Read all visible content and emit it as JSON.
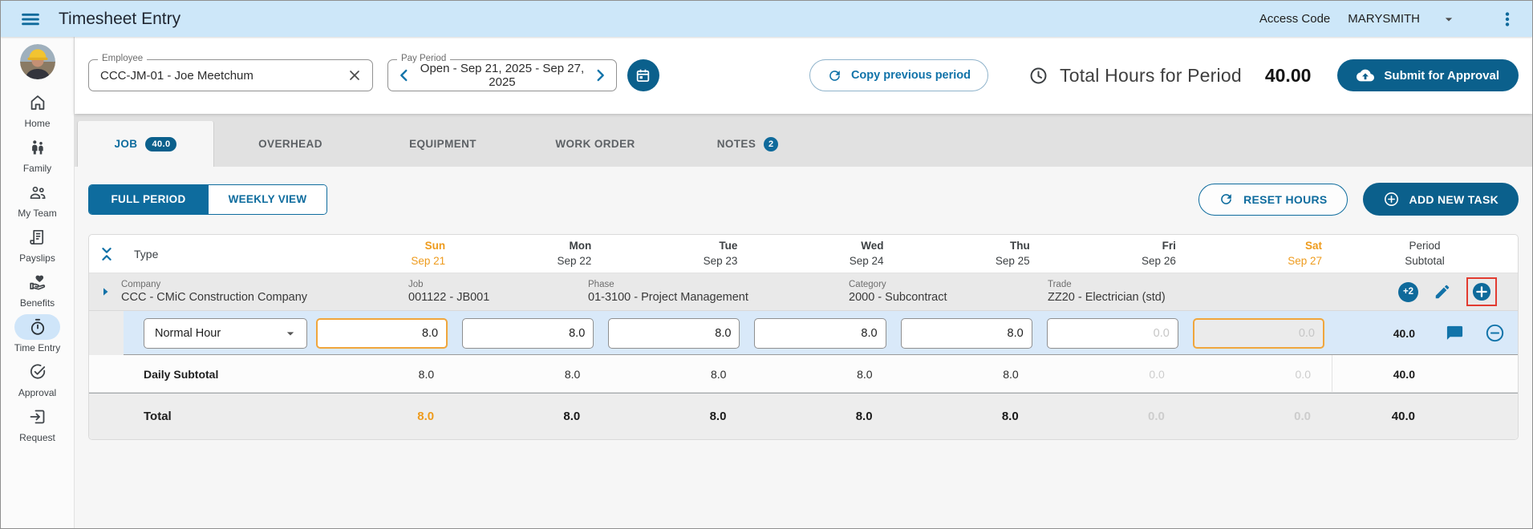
{
  "topbar": {
    "title": "Timesheet Entry",
    "access_code_label": "Access Code",
    "access_code_value": "MARYSMITH"
  },
  "sidebar": {
    "items": [
      {
        "label": "Home"
      },
      {
        "label": "Family"
      },
      {
        "label": "My Team"
      },
      {
        "label": "Payslips"
      },
      {
        "label": "Benefits"
      },
      {
        "label": "Time Entry"
      },
      {
        "label": "Approval"
      },
      {
        "label": "Request"
      }
    ]
  },
  "header": {
    "employee_label": "Employee",
    "employee_value": "CCC-JM-01 - Joe Meetchum",
    "pay_period_label": "Pay Period",
    "pay_period_value": "Open - Sep 21, 2025 - Sep 27, 2025",
    "copy_previous_label": "Copy previous period",
    "total_hours_label": "Total Hours for Period",
    "total_hours_value": "40.00",
    "submit_label": "Submit for Approval"
  },
  "tabs": {
    "job": {
      "label": "JOB",
      "badge": "40.0"
    },
    "overhead": {
      "label": "OVERHEAD"
    },
    "equipment": {
      "label": "EQUIPMENT"
    },
    "work_order": {
      "label": "WORK ORDER"
    },
    "notes": {
      "label": "NOTES",
      "badge": "2"
    }
  },
  "toolbar": {
    "full_period": "FULL PERIOD",
    "weekly_view": "WEEKLY VIEW",
    "reset_label": "RESET HOURS",
    "add_task_label": "ADD NEW TASK"
  },
  "table": {
    "type_header": "Type",
    "period_header_line1": "Period",
    "period_header_line2": "Subtotal",
    "days": [
      {
        "name": "Sun",
        "date": "Sep 21"
      },
      {
        "name": "Mon",
        "date": "Sep 22"
      },
      {
        "name": "Tue",
        "date": "Sep 23"
      },
      {
        "name": "Wed",
        "date": "Sep 24"
      },
      {
        "name": "Thu",
        "date": "Sep 25"
      },
      {
        "name": "Fri",
        "date": "Sep 26"
      },
      {
        "name": "Sat",
        "date": "Sep 27"
      }
    ],
    "task": {
      "company_label": "Company",
      "company_value": "CCC - CMiC Construction Company",
      "job_label": "Job",
      "job_value": "001122 - JB001",
      "phase_label": "Phase",
      "phase_value": "01-3100 - Project Management",
      "category_label": "Category",
      "category_value": "2000 - Subcontract",
      "trade_label": "Trade",
      "trade_value": "ZZ20 - Electrician (std)",
      "more_badge": "+2"
    },
    "entry": {
      "type_value": "Normal Hour",
      "hours": [
        "8.0",
        "8.0",
        "8.0",
        "8.0",
        "8.0",
        "0.0",
        "0.0"
      ],
      "subtotal": "40.0"
    },
    "daily_subtotal": {
      "label": "Daily Subtotal",
      "values": [
        "8.0",
        "8.0",
        "8.0",
        "8.0",
        "8.0",
        "0.0",
        "0.0"
      ],
      "subtotal": "40.0"
    },
    "total": {
      "label": "Total",
      "values": [
        "8.0",
        "8.0",
        "8.0",
        "8.0",
        "8.0",
        "0.0",
        "0.0"
      ],
      "subtotal": "40.0"
    }
  },
  "colors": {
    "primary": "#0b608c",
    "accent_blue": "#1173a9",
    "weekend_orange": "#ee9b1d",
    "highlight_red": "#e23b30",
    "topbar_blue": "#cde7f9"
  }
}
